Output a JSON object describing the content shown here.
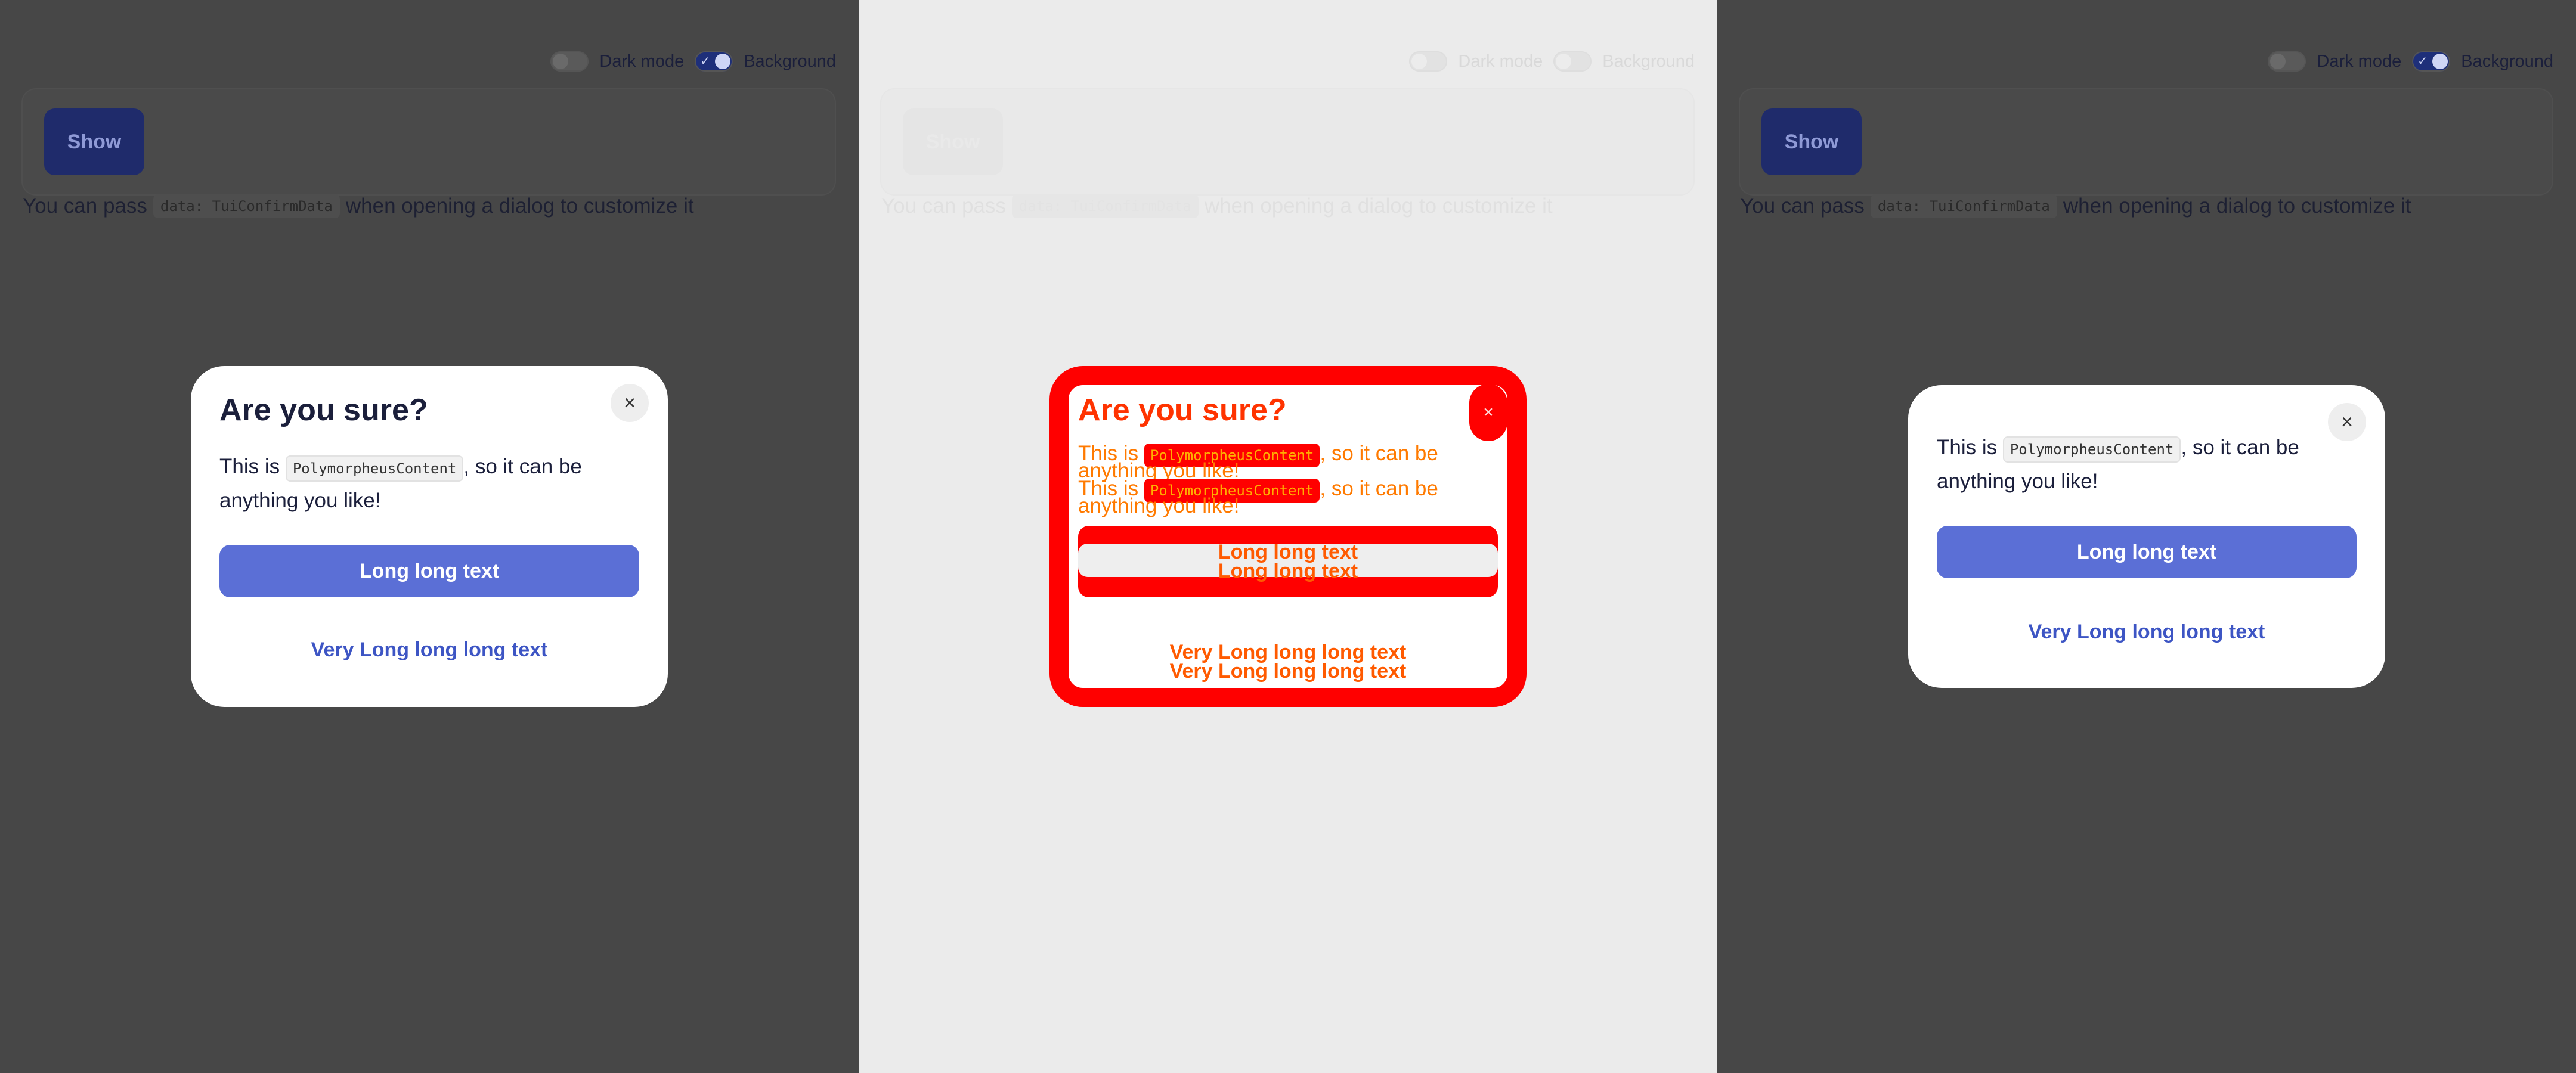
{
  "toggles": {
    "dark_mode": "Dark mode",
    "background": "Background"
  },
  "demo": {
    "show_label": "Show"
  },
  "description": {
    "before": "You can pass",
    "code": "data: TuiConfirmData",
    "after": "when opening a dialog to customize it"
  },
  "dialog": {
    "title": "Are you sure?",
    "close_icon": "×",
    "text_before": "This is",
    "text_code": "PolymorpheusContent",
    "text_after": ", so it can be anything you like!",
    "primary_label": "Long long text",
    "secondary_label": "Very Long long long text"
  },
  "colors": {
    "accent": "#5b6fd6",
    "link": "#3d55c4",
    "diff": "#ff0000"
  }
}
